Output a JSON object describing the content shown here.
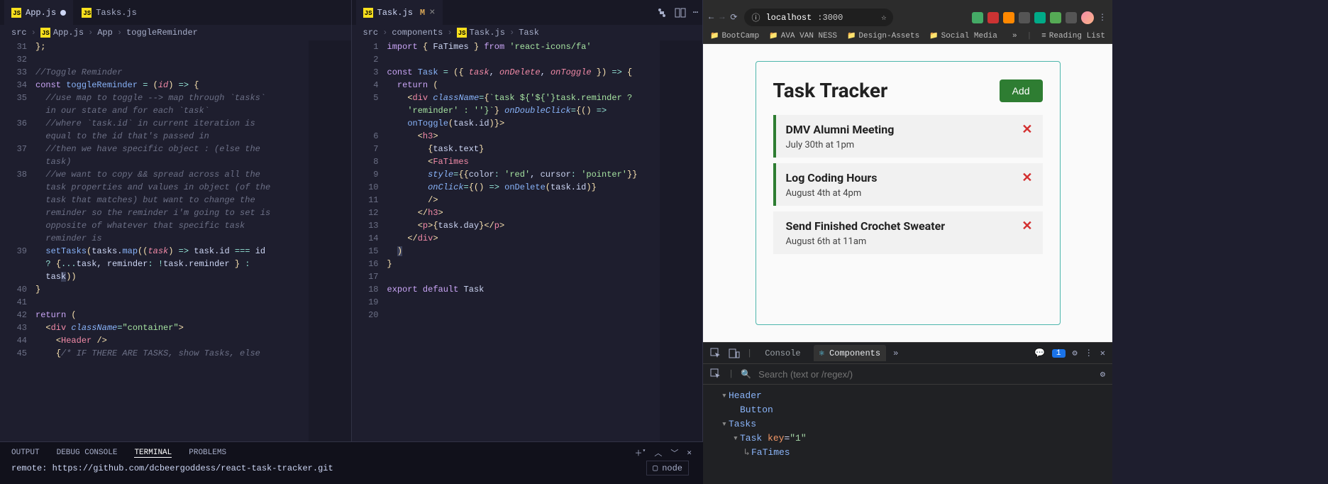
{
  "vscode": {
    "left": {
      "tabs": [
        {
          "name": "App.js",
          "dirty": true,
          "active": true
        },
        {
          "name": "Tasks.js",
          "dirty": false,
          "active": false
        }
      ],
      "breadcrumbs": [
        "src",
        "App.js",
        "App",
        "toggleReminder"
      ],
      "lines": [
        {
          "n": 31,
          "html": "<span class='c-punc'>};</span>"
        },
        {
          "n": 32,
          "html": ""
        },
        {
          "n": 33,
          "html": "<span class='c-com'>//Toggle Reminder</span>"
        },
        {
          "n": 34,
          "html": "<span class='c-kw'>const</span> <span class='c-fn'>toggleReminder</span> <span class='c-op'>=</span> <span class='c-punc'>(</span><span class='c-var'>id</span><span class='c-punc'>)</span> <span class='c-op'>=&gt;</span> <span class='c-punc'>{</span>"
        },
        {
          "n": 35,
          "html": "  <span class='c-com'>//use map to toggle --&gt; map through `tasks`</span>"
        },
        {
          "n": "",
          "html": "  <span class='c-com'>in our state and for each `task`</span>"
        },
        {
          "n": 36,
          "html": "  <span class='c-com'>//where `task.id` in current iteration is</span>"
        },
        {
          "n": "",
          "html": "  <span class='c-com'>equal to the id that's passed in</span>"
        },
        {
          "n": 37,
          "html": "  <span class='c-com'>//then we have specific object : (else the</span>"
        },
        {
          "n": "",
          "html": "  <span class='c-com'>task)</span>"
        },
        {
          "n": 38,
          "html": "  <span class='c-com'>//we want to copy &amp;&amp; spread across all the</span>"
        },
        {
          "n": "",
          "html": "  <span class='c-com'>task properties and values in object (of the</span>"
        },
        {
          "n": "",
          "html": "  <span class='c-com'>task that matches) but want to change the</span>"
        },
        {
          "n": "",
          "html": "  <span class='c-com'>reminder so the reminder i'm going to set is</span>"
        },
        {
          "n": "",
          "html": "  <span class='c-com'>opposite of whatever that specific task</span>"
        },
        {
          "n": "",
          "html": "  <span class='c-com'>reminder is</span>"
        },
        {
          "n": 39,
          "html": "  <span class='c-fn'>setTasks</span><span class='c-punc'>(</span>tasks.<span class='c-fn'>map</span><span class='c-punc'>((</span><span class='c-var'>task</span><span class='c-punc'>)</span> <span class='c-op'>=&gt;</span> task.id <span class='c-op'>===</span> id"
        },
        {
          "n": "",
          "html": "  <span class='c-op'>?</span> <span class='c-punc'>{</span><span class='c-op'>...</span>task, reminder<span class='c-op'>:</span> <span class='c-op'>!</span>task.reminder <span class='c-punc'>}</span> <span class='c-op'>:</span>"
        },
        {
          "n": "",
          "html": "  tas<span style='background:#3a3f58'>k</span><span class='c-punc'>))</span>"
        },
        {
          "n": 40,
          "html": "<span class='c-punc'>}</span>"
        },
        {
          "n": 41,
          "html": ""
        },
        {
          "n": 42,
          "html": "<span class='c-kw'>return</span> <span class='c-punc'>(</span>"
        },
        {
          "n": 43,
          "html": "  <span class='c-punc'>&lt;</span><span class='c-tag'>div</span> <span class='c-attr'>className</span><span class='c-op'>=</span><span class='c-str'>\"container\"</span><span class='c-punc'>&gt;</span>"
        },
        {
          "n": 44,
          "html": "    <span class='c-punc'>&lt;</span><span class='c-tag'>Header</span> <span class='c-punc'>/&gt;</span>"
        },
        {
          "n": 45,
          "html": "    <span class='c-punc'>{</span><span class='c-com'>/* IF THERE ARE TASKS, show Tasks, else</span>"
        }
      ]
    },
    "right": {
      "tabs": [
        {
          "name": "Task.js",
          "mod": "M",
          "active": true
        }
      ],
      "breadcrumbs": [
        "src",
        "components",
        "Task.js",
        "Task"
      ],
      "lines": [
        {
          "n": 1,
          "html": "<span class='c-kw'>import</span> <span class='c-punc'>{</span> FaTimes <span class='c-punc'>}</span> <span class='c-kw'>from</span> <span class='c-str'>'react-icons/fa'</span>"
        },
        {
          "n": 2,
          "html": ""
        },
        {
          "n": 3,
          "html": "<span class='c-kw'>const</span> <span class='c-fn'>Task</span> <span class='c-op'>=</span> <span class='c-punc'>({</span> <span class='c-var'>task</span>, <span class='c-var'>onDelete</span>, <span class='c-var'>onToggle</span> <span class='c-punc'>})</span> <span class='c-op'>=&gt;</span> <span class='c-punc'>{</span>"
        },
        {
          "n": 4,
          "html": "  <span class='c-kw'>return</span> <span class='c-punc'>(</span>"
        },
        {
          "n": 5,
          "html": "    <span class='c-punc'>&lt;</span><span class='c-tag'>div</span> <span class='c-attr'>className</span><span class='c-op'>=</span><span class='c-punc'>{</span><span class='c-str'>`task ${'${'}task.reminder ?</span>"
        },
        {
          "n": "",
          "html": "    <span class='c-str'>'reminder' : ''}`</span><span class='c-punc'>}</span> <span class='c-attr'>onDoubleClick</span><span class='c-op'>=</span><span class='c-punc'>{()</span> <span class='c-op'>=&gt;</span>"
        },
        {
          "n": "",
          "html": "    <span class='c-fn'>onToggle</span><span class='c-punc'>(</span>task.id<span class='c-punc'>)}&gt;</span>"
        },
        {
          "n": 6,
          "html": "      <span class='c-punc'>&lt;</span><span class='c-tag'>h3</span><span class='c-punc'>&gt;</span>"
        },
        {
          "n": 7,
          "html": "        <span class='c-punc'>{</span>task.text<span class='c-punc'>}</span>"
        },
        {
          "n": 8,
          "html": "        <span class='c-punc'>&lt;</span><span class='c-tag'>FaTimes</span>"
        },
        {
          "n": 9,
          "html": "        <span class='c-attr'>style</span><span class='c-op'>=</span><span class='c-punc'>{{</span>color<span class='c-op'>:</span> <span class='c-str'>'red'</span>, cursor<span class='c-op'>:</span> <span class='c-str'>'pointer'</span><span class='c-punc'>}}</span>"
        },
        {
          "n": 10,
          "html": "        <span class='c-attr'>onClick</span><span class='c-op'>=</span><span class='c-punc'>{()</span> <span class='c-op'>=&gt;</span> <span class='c-fn'>onDelete</span><span class='c-punc'>(</span>task.id<span class='c-punc'>)}</span>"
        },
        {
          "n": 11,
          "html": "        <span class='c-punc'>/&gt;</span>"
        },
        {
          "n": 12,
          "html": "      <span class='c-punc'>&lt;/</span><span class='c-tag'>h3</span><span class='c-punc'>&gt;</span>"
        },
        {
          "n": 13,
          "html": "      <span class='c-punc'>&lt;</span><span class='c-tag'>p</span><span class='c-punc'>&gt;{</span>task.day<span class='c-punc'>}&lt;/</span><span class='c-tag'>p</span><span class='c-punc'>&gt;</span>"
        },
        {
          "n": 14,
          "html": "    <span class='c-punc'>&lt;/</span><span class='c-tag'>div</span><span class='c-punc'>&gt;</span>"
        },
        {
          "n": 15,
          "html": "  <span class='c-punc' style='background:#3a3f58'>)</span>"
        },
        {
          "n": 16,
          "html": "<span class='c-punc'>}</span>"
        },
        {
          "n": 17,
          "html": ""
        },
        {
          "n": 18,
          "html": "<span class='c-kw'>export</span> <span class='c-kw'>default</span> Task"
        },
        {
          "n": 19,
          "html": ""
        },
        {
          "n": 20,
          "html": ""
        }
      ]
    },
    "panel": {
      "tabs": [
        "OUTPUT",
        "DEBUG CONSOLE",
        "TERMINAL",
        "PROBLEMS"
      ],
      "active": "TERMINAL",
      "content": "remote:   https://github.com/dcbeergoddess/react-task-tracker.git",
      "node_label": "node"
    }
  },
  "browser": {
    "url_host": "localhost",
    "url_port": ":3000",
    "bookmarks": [
      "BootCamp",
      "AVA VAN NESS",
      "Design-Assets",
      "Social Media"
    ],
    "more_label": "»",
    "reading_list": "Reading List",
    "title": "Task Tracker",
    "add_button": "Add",
    "tasks": [
      {
        "text": "DMV Alumni Meeting",
        "day": "July 30th at 1pm",
        "reminder": true
      },
      {
        "text": "Log Coding Hours",
        "day": "August 4th at 4pm",
        "reminder": true
      },
      {
        "text": "Send Finished Crochet Sweater",
        "day": "August 6th at 11am",
        "reminder": false
      }
    ]
  },
  "devtools": {
    "tabs": [
      "Console",
      "Components"
    ],
    "active": "Components",
    "badge": "1",
    "search_placeholder": "Search (text or /regex/)",
    "tree": [
      {
        "level": 0,
        "toggle": "▾",
        "name": "Header"
      },
      {
        "level": 1,
        "toggle": "",
        "name": "Button"
      },
      {
        "level": 0,
        "toggle": "▾",
        "name": "Tasks"
      },
      {
        "level": 1,
        "toggle": "▾",
        "name": "Task",
        "attr_k": "key",
        "attr_v": "\"1\""
      },
      {
        "level": 2,
        "toggle": "",
        "name": "FaTimes",
        "arrow": "↳"
      }
    ]
  }
}
